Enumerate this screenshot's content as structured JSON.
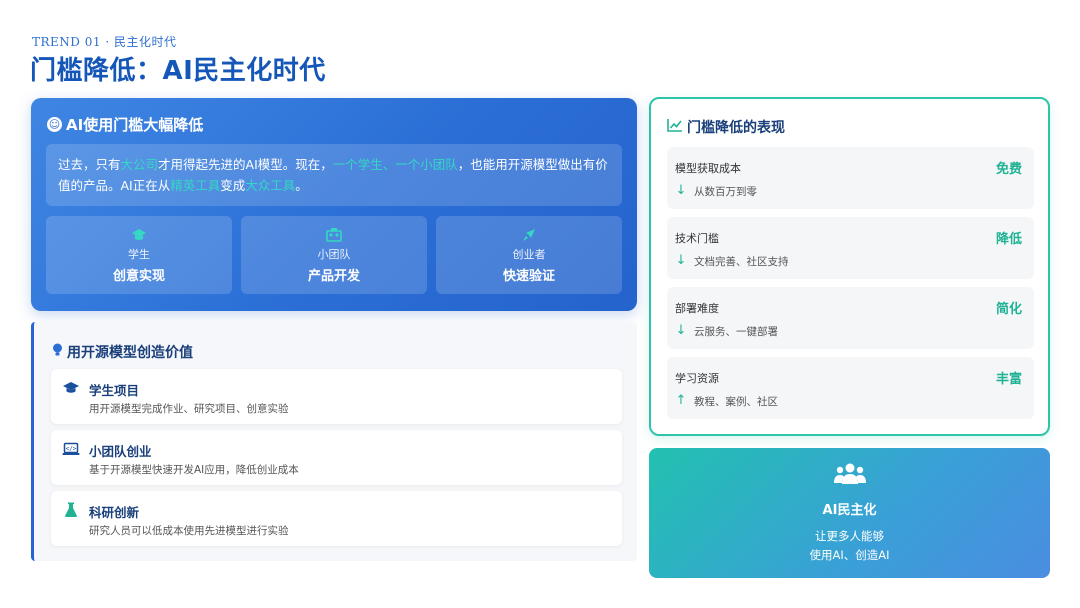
{
  "header": {
    "kicker": "TREND 01 · 民主化时代",
    "title": "门槛降低：AI民主化时代"
  },
  "hero": {
    "title": "AI使用门槛大幅降低",
    "icon": "accessibility-icon",
    "text": {
      "p1": "过去，只有",
      "h1": "大公司",
      "p2": "才用得起先进的AI模型。现在，",
      "h2": "一个学生、一个小团队",
      "p3": "，也能用开源模型做出有价值的产品。AI正在从",
      "h3": "精英工具",
      "p4": "变成",
      "h4": "大众工具",
      "p5": "。"
    },
    "tiles": [
      {
        "icon": "graduation-cap-icon",
        "sub": "学生",
        "main": "创意实现"
      },
      {
        "icon": "team-icon",
        "sub": "小团队",
        "main": "产品开发"
      },
      {
        "icon": "rocket-icon",
        "sub": "创业者",
        "main": "快速验证"
      }
    ]
  },
  "value": {
    "title": "用开源模型创造价值",
    "icon": "lightbulb-icon",
    "items": [
      {
        "icon": "graduation-cap-icon",
        "title": "学生项目",
        "desc": "用开源模型完成作业、研究项目、创意实验"
      },
      {
        "icon": "laptop-code-icon",
        "title": "小团队创业",
        "desc": "基于开源模型快速开发AI应用，降低创业成本"
      },
      {
        "icon": "flask-icon",
        "title": "科研创新",
        "desc": "研究人员可以低成本使用先进模型进行实验"
      }
    ]
  },
  "manif": {
    "title": "门槛降低的表现",
    "icon": "line-chart-icon",
    "rows": [
      {
        "label": "模型获取成本",
        "value": "免费",
        "arrow": "↓",
        "desc": "从数百万到零"
      },
      {
        "label": "技术门槛",
        "value": "降低",
        "arrow": "↓",
        "desc": "文档完善、社区支持"
      },
      {
        "label": "部署难度",
        "value": "简化",
        "arrow": "↓",
        "desc": "云服务、一键部署"
      },
      {
        "label": "学习资源",
        "value": "丰富",
        "arrow": "↑",
        "desc": "教程、案例、社区"
      }
    ]
  },
  "democ": {
    "icon": "users-icon",
    "title": "AI民主化",
    "line1": "让更多人能够",
    "line2": "使用AI、创造AI"
  },
  "colors": {
    "primary": "#2b6fd6",
    "accent": "#1fb394",
    "title": "#1557b8"
  }
}
